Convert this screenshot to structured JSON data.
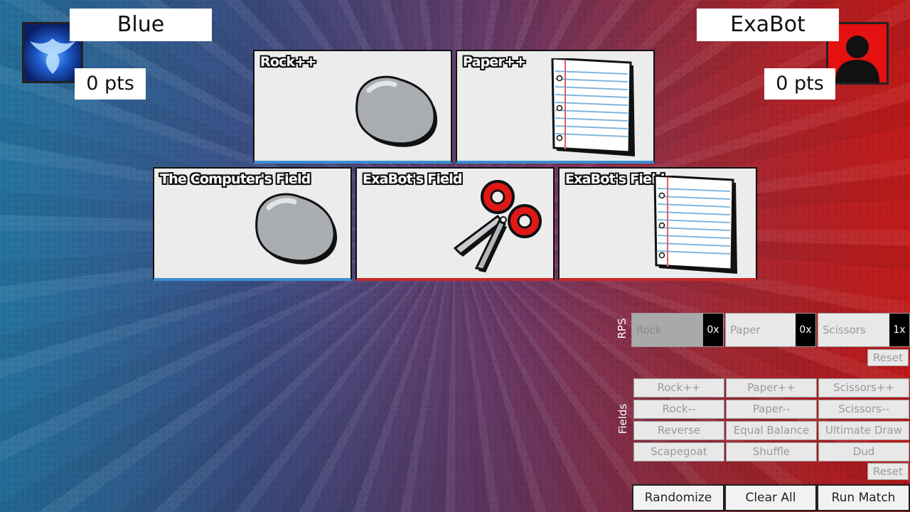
{
  "players": {
    "left": {
      "name": "Blue",
      "points": "0 pts"
    },
    "right": {
      "name": "ExaBot",
      "points": "0 pts"
    }
  },
  "cards_top": [
    {
      "title": "Rock++",
      "icon": "rock-icon"
    },
    {
      "title": "Paper++",
      "icon": "paper-icon"
    }
  ],
  "cards_bottom": [
    {
      "title": "The Computer's Field",
      "icon": "rock-icon"
    },
    {
      "title": "ExaBot's Field",
      "icon": "scissors-icon"
    },
    {
      "title": "ExaBot's Field",
      "icon": "paper-icon"
    }
  ],
  "rps": {
    "label": "RPS",
    "items": [
      {
        "label": "Rock",
        "count": "0x"
      },
      {
        "label": "Paper",
        "count": "0x"
      },
      {
        "label": "Scissors",
        "count": "1x"
      }
    ],
    "reset": "Reset"
  },
  "fields": {
    "label": "Fields",
    "items": [
      "Rock++",
      "Paper++",
      "Scissors++",
      "Rock--",
      "Paper--",
      "Scissors--",
      "Reverse",
      "Equal Balance",
      "Ultimate Draw",
      "Scapegoat",
      "Shuffle",
      "Dud"
    ],
    "reset": "Reset"
  },
  "actions": {
    "randomize": "Randomize",
    "clear_all": "Clear All",
    "run_match": "Run Match"
  },
  "colors": {
    "blue_side": "#2a7fb0",
    "red_side": "#d41c1c",
    "card_bg": "#ececec"
  }
}
